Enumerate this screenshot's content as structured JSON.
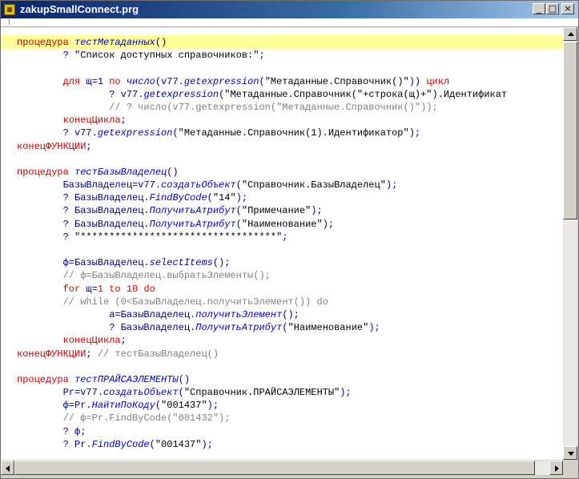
{
  "window": {
    "title": "zakupSmallConnect.prg"
  },
  "titlebar_buttons": {
    "minimize": "_",
    "maximize": "□",
    "close": "×"
  },
  "icons": {
    "app": "prg-file-icon",
    "scroll_up": "arrow-up-icon",
    "scroll_down": "arrow-down-icon",
    "scroll_left": "arrow-left-icon",
    "scroll_right": "arrow-right-icon"
  },
  "colors": {
    "keyword": "#cc0000",
    "function": "#0000cc",
    "identifier": "#000080",
    "string": "#000000",
    "comment": "#808080",
    "current_line": "#ffff99"
  },
  "code": {
    "lines": [
      [
        [
          "kw",
          "процедура "
        ],
        [
          "fn",
          "тестМетаданных"
        ],
        [
          "id",
          "()"
        ]
      ],
      [
        [
          "id",
          "        ? "
        ],
        [
          "str",
          "\"Список доступных справочников:\""
        ],
        [
          "id",
          ";"
        ]
      ],
      [
        [
          "id",
          ""
        ]
      ],
      [
        [
          "kw",
          "        для "
        ],
        [
          "id",
          "щ=1 "
        ],
        [
          "kw",
          "по "
        ],
        [
          "fn",
          "число"
        ],
        [
          "id",
          "(v77."
        ],
        [
          "fn",
          "getexpression"
        ],
        [
          "id",
          "("
        ],
        [
          "str",
          "\"Метаданные.Справочник()\""
        ],
        [
          "id",
          "))"
        ],
        [
          "kw",
          " цикл"
        ]
      ],
      [
        [
          "id",
          "                ? v77."
        ],
        [
          "fn",
          "getexpression"
        ],
        [
          "id",
          "("
        ],
        [
          "str",
          "\"Метаданные.Справочник(\"+строка(щ)+\").Идентификат"
        ]
      ],
      [
        [
          "cm",
          "                // ? число(v77.getexpression(\"Метаданные.Справочник()\"));"
        ]
      ],
      [
        [
          "kw",
          "        конецЦикла"
        ],
        [
          "id",
          ";"
        ]
      ],
      [
        [
          "id",
          "        ? v77."
        ],
        [
          "fn",
          "getexpression"
        ],
        [
          "id",
          "("
        ],
        [
          "str",
          "\"Метаданные.Справочник(1).Идентификатор\""
        ],
        [
          "id",
          ");"
        ]
      ],
      [
        [
          "kw",
          "конецФУНКЦИИ"
        ],
        [
          "id",
          ";"
        ]
      ],
      [
        [
          "id",
          ""
        ]
      ],
      [
        [
          "kw",
          "процедура "
        ],
        [
          "fn",
          "тестБазыВладелец"
        ],
        [
          "id",
          "()"
        ]
      ],
      [
        [
          "id",
          "        БазыВладелец=v77."
        ],
        [
          "fn",
          "создатьОбъект"
        ],
        [
          "id",
          "("
        ],
        [
          "str",
          "\"Справочник.БазыВладелец\""
        ],
        [
          "id",
          ");"
        ]
      ],
      [
        [
          "id",
          "        ? БазыВладелец."
        ],
        [
          "fn",
          "FindByCode"
        ],
        [
          "id",
          "("
        ],
        [
          "str",
          "\"14\""
        ],
        [
          "id",
          ");"
        ]
      ],
      [
        [
          "id",
          "        ? БазыВладелец."
        ],
        [
          "fn",
          "ПолучитьАтрибут"
        ],
        [
          "id",
          "("
        ],
        [
          "str",
          "\"Примечание\""
        ],
        [
          "id",
          ");"
        ]
      ],
      [
        [
          "id",
          "        ? БазыВладелец."
        ],
        [
          "fn",
          "ПолучитьАтрибут"
        ],
        [
          "id",
          "("
        ],
        [
          "str",
          "\"Наименование\""
        ],
        [
          "id",
          ");"
        ]
      ],
      [
        [
          "id",
          "        ? "
        ],
        [
          "str",
          "\"**********************************\""
        ],
        [
          "id",
          ";"
        ]
      ],
      [
        [
          "id",
          ""
        ]
      ],
      [
        [
          "id",
          "        ф=БазыВладелец."
        ],
        [
          "fn",
          "selectItems"
        ],
        [
          "id",
          "();"
        ]
      ],
      [
        [
          "cm",
          "        // ф=БазыВладелец.выбратьЭлементы();"
        ]
      ],
      [
        [
          "kw",
          "        for "
        ],
        [
          "id",
          "щ="
        ],
        [
          "nm",
          "1"
        ],
        [
          "kw",
          " to "
        ],
        [
          "nm",
          "10"
        ],
        [
          "kw",
          " do"
        ]
      ],
      [
        [
          "cm",
          "        // while (0<БазыВладелец.получитьЭлемент()) do"
        ]
      ],
      [
        [
          "id",
          "                а=БазыВладелец."
        ],
        [
          "fn",
          "получитьЭлемент"
        ],
        [
          "id",
          "();"
        ]
      ],
      [
        [
          "id",
          "                ? БазыВладелец."
        ],
        [
          "fn",
          "ПолучитьАтрибут"
        ],
        [
          "id",
          "("
        ],
        [
          "str",
          "\"Наименование\""
        ],
        [
          "id",
          ");"
        ]
      ],
      [
        [
          "kw",
          "        конецЦикла"
        ],
        [
          "id",
          ";"
        ]
      ],
      [
        [
          "kw",
          "конецФУНКЦИИ"
        ],
        [
          "id",
          "; "
        ],
        [
          "cm",
          "// тестБазыВладелец()"
        ]
      ],
      [
        [
          "id",
          ""
        ]
      ],
      [
        [
          "kw",
          "процедура "
        ],
        [
          "fn",
          "тестПРАЙСАЭЛЕМЕНТЫ"
        ],
        [
          "id",
          "()"
        ]
      ],
      [
        [
          "id",
          "        Pr=v77."
        ],
        [
          "fn",
          "создатьОбъект"
        ],
        [
          "id",
          "("
        ],
        [
          "str",
          "\"Справочник.ПРАЙСАЭЛЕМЕНТЫ\""
        ],
        [
          "id",
          ");"
        ]
      ],
      [
        [
          "id",
          "        ф=Pr."
        ],
        [
          "fn",
          "НайтиПоКоду"
        ],
        [
          "id",
          "("
        ],
        [
          "str",
          "\"001437\""
        ],
        [
          "id",
          ");"
        ]
      ],
      [
        [
          "cm",
          "        // ф=Pr.FindByCode(\"001432\");"
        ]
      ],
      [
        [
          "id",
          "        ? ф;"
        ]
      ],
      [
        [
          "id",
          "        ? Pr."
        ],
        [
          "fn",
          "FindByCode"
        ],
        [
          "id",
          "("
        ],
        [
          "str",
          "\"001437\""
        ],
        [
          "id",
          ");"
        ]
      ]
    ]
  }
}
